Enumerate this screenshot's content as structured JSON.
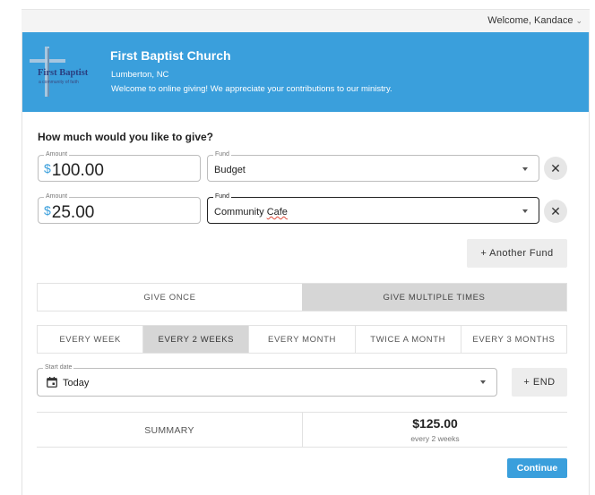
{
  "header": {
    "welcome_text": "Welcome, Kandace",
    "church_name": "First Baptist Church",
    "church_city": "Lumberton, NC",
    "church_welcome": "Welcome to online giving! We appreciate your contributions to our ministry.",
    "logo_title": "First Baptist",
    "logo_tagline": "a community of faith",
    "brand_color": "#3a9fdc"
  },
  "form": {
    "question": "How much would you like to give?",
    "currency_symbol": "$",
    "rows": [
      {
        "amount_label": "Amount",
        "amount": "100.00",
        "fund_label": "Fund",
        "fund": "Budget"
      },
      {
        "amount_label": "Amount",
        "amount": "25.00",
        "fund_label": "Fund",
        "fund_prefix": "Community ",
        "fund_suffix": "Cafe"
      }
    ],
    "another_fund_label": "+ Another Fund"
  },
  "give_mode": {
    "options": [
      "GIVE ONCE",
      "GIVE MULTIPLE TIMES"
    ],
    "selected": "GIVE MULTIPLE TIMES"
  },
  "frequency": {
    "options": [
      "EVERY WEEK",
      "EVERY 2 WEEKS",
      "EVERY MONTH",
      "TWICE A MONTH",
      "EVERY 3 MONTHS"
    ],
    "selected": "EVERY 2 WEEKS"
  },
  "schedule": {
    "start_date_label": "Start date",
    "start_date": "Today",
    "end_button": "+ END"
  },
  "summary": {
    "label": "SUMMARY",
    "total": "$125.00",
    "frequency_text": "every 2 weeks"
  },
  "actions": {
    "continue": "Continue"
  },
  "icons": {
    "close": "close-icon",
    "dropdown": "chevron-down-icon",
    "calendar": "calendar-icon",
    "user_menu": "caret-down-icon"
  }
}
